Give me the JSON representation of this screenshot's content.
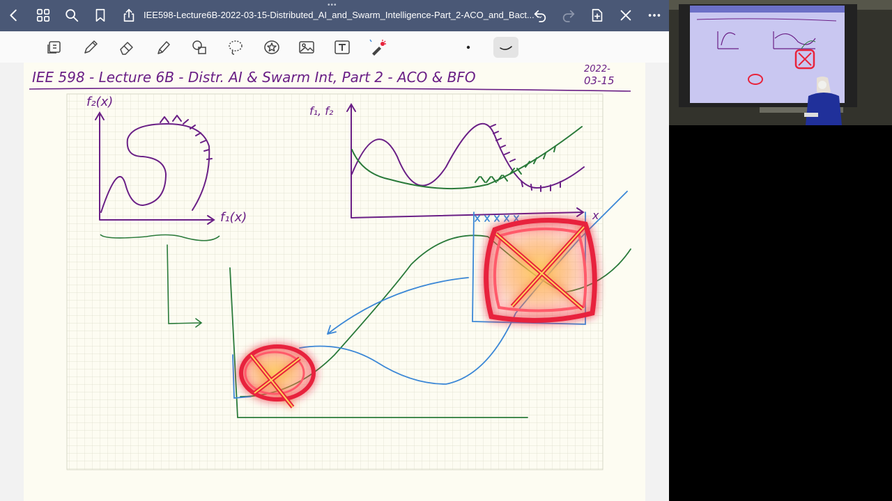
{
  "header": {
    "document_title": "IEE598-Lecture6B-2022-03-15-Distributed_AI_and_Swarm_Intelligence-Part_2-ACO_and_Bact...",
    "title_chevron": "⌄",
    "icons": [
      "back-icon",
      "grid-icon",
      "search-icon",
      "bookmark-icon",
      "share-icon",
      "undo-icon",
      "redo-icon",
      "add-page-icon",
      "close-icon",
      "more-icon"
    ]
  },
  "toolbar": {
    "tools": [
      "lasso-icon",
      "pen-icon",
      "eraser-icon",
      "highlighter-icon",
      "shapes-icon",
      "lasso-select-icon",
      "sticker-icon",
      "image-icon",
      "text-icon",
      "laser-pointer-icon"
    ],
    "active_tool": "laser-pointer-icon"
  },
  "page": {
    "handwritten_title": "IEE 598 - Lecture 6B - Distr. AI & Swarm Int, Part 2 - ACO & BFO",
    "date_line1": "2022-",
    "date_line2": "03-15",
    "labels": {
      "f2x": "f₂(x)",
      "f1x": "f₁(x)",
      "f1f2": "f₁, f₂",
      "x": "x"
    }
  },
  "colors": {
    "ink_purple": "#6a1f86",
    "ink_green": "#2a7a3a",
    "ink_blue": "#3b87d6",
    "laser_red": "#e8243c",
    "grid": "#d8d8cc",
    "paper": "#fdfcf2",
    "titlebar": "#4a5876"
  }
}
